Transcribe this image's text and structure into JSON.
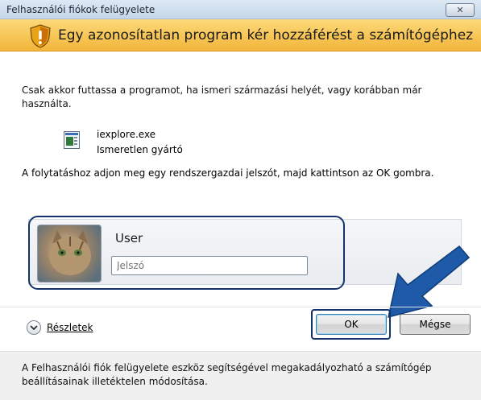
{
  "window": {
    "title": "Felhasználói fiókok felügyelete",
    "close_label": "✕"
  },
  "banner": {
    "text": "Egy azonosítatlan program kér hozzáférést a számítógéphez",
    "icon": "warning-shield-icon"
  },
  "intro_text": "Csak akkor futtassa a programot, ha ismeri származási helyét, vagy korábban már használta.",
  "program": {
    "name": "iexplore.exe",
    "publisher": "Ismeretlen gyártó",
    "icon": "application-icon"
  },
  "instruction_text": "A folytatáshoz adjon meg egy rendszergazdai jelszót, majd kattintson az OK gombra.",
  "credentials": {
    "username": "User",
    "password_placeholder": "Jelszó"
  },
  "details": {
    "label": "Részletek",
    "icon": "chevron-down-icon"
  },
  "buttons": {
    "ok": "OK",
    "cancel": "Mégse"
  },
  "footer_text": "A Felhasználói fiók felügyelete eszköz segítségével megakadályozható a számítógép beállításainak illetéktelen módosítása.",
  "colors": {
    "banner": "#f3b53a",
    "highlight": "#14336a",
    "arrow": "#1e5aa8"
  }
}
